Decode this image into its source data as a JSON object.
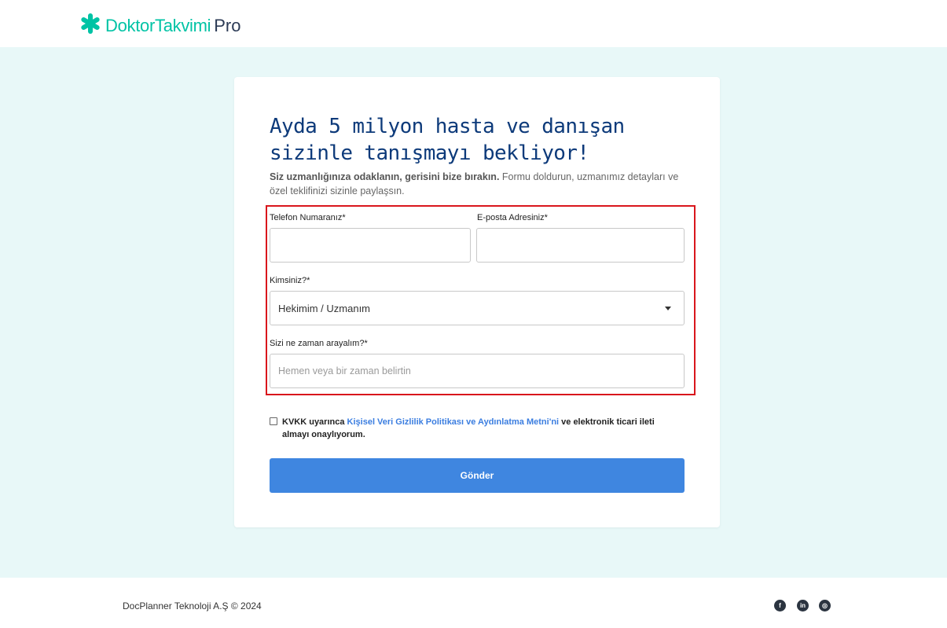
{
  "brand": {
    "name": "DoktorTakvimi",
    "suffix": "Pro",
    "color": "#00c3a5",
    "icon": "star-logo-icon"
  },
  "form": {
    "title": "Ayda 5 milyon hasta ve danışan sizinle tanışmayı bekliyor!",
    "subtitle_bold": "Siz uzmanlığınıza odaklanın, gerisini bize bırakın.",
    "subtitle_rest": " Formu doldurun, uzmanımız detayları ve özel teklifinizi sizinle paylaşsın.",
    "phone_label": "Telefon Numaranız*",
    "phone_value": "",
    "email_label": "E-posta Adresiniz*",
    "email_value": "",
    "role_label": "Kimsiniz?*",
    "role_selected": "Hekimim / Uzmanım",
    "call_label": "Sizi ne zaman arayalım?*",
    "call_placeholder": "Hemen veya bir zaman belirtin",
    "consent_prefix": "KVKK uyarınca ",
    "consent_link": "Kişisel Veri Gizlilik Politikası ve Aydınlatma Metni'ni",
    "consent_suffix": " ve elektronik ticari ileti almayı onaylıyorum.",
    "consent_checked": false,
    "submit_label": "Gönder",
    "accent_color": "#3f86e0",
    "highlight_color": "#d9161c"
  },
  "footer": {
    "copyright": "DocPlanner Teknoloji A.Ş © 2024",
    "social": [
      {
        "name": "facebook-icon",
        "glyph": "f"
      },
      {
        "name": "linkedin-icon",
        "glyph": "in"
      },
      {
        "name": "instagram-icon",
        "glyph": "◎"
      }
    ]
  }
}
